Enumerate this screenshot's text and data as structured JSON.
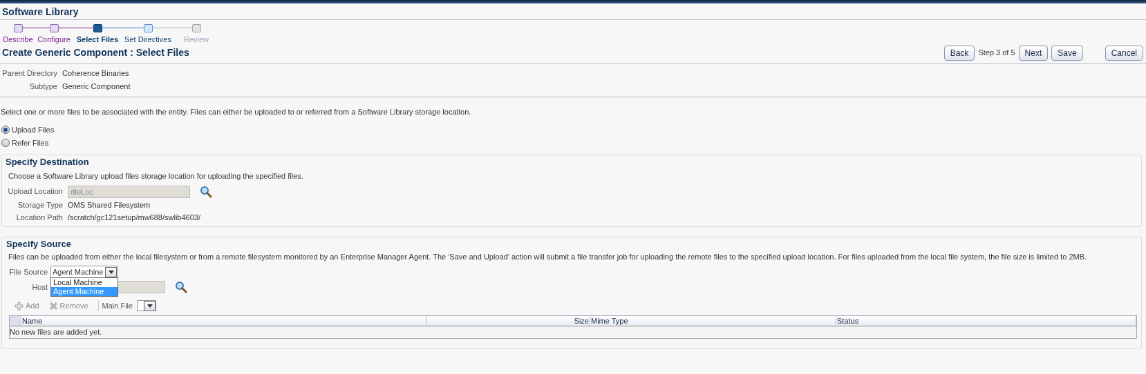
{
  "page_title": "Software Library",
  "train": [
    {
      "label": "Describe",
      "visited": true,
      "selected": false
    },
    {
      "label": "Configure",
      "visited": true,
      "selected": false
    },
    {
      "label": "Select Files",
      "selected": true
    },
    {
      "label": "Set Directives",
      "selected": false
    },
    {
      "label": "Review",
      "selected": false,
      "disabled": true
    }
  ],
  "heading": "Create Generic Component : Select Files",
  "nav": {
    "back": "Back",
    "step": "Step 3 of 5",
    "next": "Next",
    "save": "Save",
    "cancel": "Cancel"
  },
  "info": [
    {
      "label": "Parent Directory",
      "value": "Coherence Binaries"
    },
    {
      "label": "Subtype",
      "value": "Generic Component"
    }
  ],
  "instruction": "Select one or more files to be associated with the entity. Files can either be uploaded to or referred from a Software Library storage location.",
  "mode": [
    {
      "label": "Upload Files",
      "selected": true
    },
    {
      "label": "Refer Files",
      "selected": false
    }
  ],
  "destination": {
    "title": "Specify Destination",
    "description": "Choose a Software Library upload files storage location for uploading the specified files.",
    "upload_location": {
      "label": "Upload Location",
      "value": "dteLoc",
      "disabled": true
    },
    "fields": [
      {
        "label": "Storage Type",
        "value": "OMS Shared Filesystem"
      },
      {
        "label": "Location Path",
        "value": "/scratch/gc121setup/mw688/swlib4603/"
      }
    ]
  },
  "source": {
    "title": "Specify Source",
    "description": "Files can be uploaded from either the local filesystem or from a remote filesystem monitored by an Enterprise Manager Agent. The 'Save and Upload' action will submit a file transfer job for uploading the remote files to the specified upload location. For files uploaded from the local file system, the file size is limited to 2MB.",
    "file_source": {
      "label": "File Source",
      "value": "Agent Machine",
      "options": [
        {
          "label": "Local Machine",
          "selected": false
        },
        {
          "label": "Agent Machine",
          "selected": true
        }
      ]
    },
    "host": {
      "label": "Host"
    },
    "toolbar": {
      "add": "Add",
      "remove": "Remove",
      "main_file": "Main File"
    },
    "table": {
      "columns": [
        "Name",
        "Size",
        "Mime Type",
        "Status"
      ],
      "empty": "No new files are added yet."
    }
  }
}
